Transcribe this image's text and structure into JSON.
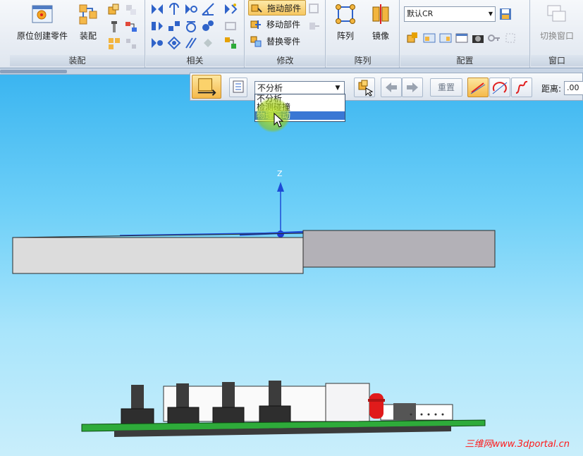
{
  "ribbon": {
    "assembly": {
      "create_in_place_label": "原位创建零件",
      "assemble_label": "装配",
      "group_label": "装配"
    },
    "relations": {
      "group_label": "相关"
    },
    "modify": {
      "drag_part_label": "拖动部件",
      "move_part_label": "移动部件",
      "replace_part_label": "替换零件",
      "group_label": "修改"
    },
    "pattern": {
      "pattern_label": "阵列",
      "mirror_label": "镜像",
      "group_label": "阵列"
    },
    "config": {
      "config_value": "默认CR",
      "group_label": "配置"
    },
    "window": {
      "switch_window_label": "切换窗口",
      "group_label": "窗口"
    }
  },
  "command_bar": {
    "analysis_select_value": "不分析",
    "analysis_options": [
      "不分析",
      "检测碰撞",
      "物理运动"
    ],
    "selected_option_index": 2,
    "reset_label": "重置",
    "distance_label": "距离:",
    "distance_value": ".00"
  },
  "viewport": {
    "z_axis_label": "Z"
  },
  "watermark": "三维网www.3dportal.cn",
  "colors": {
    "accent": "#f5b94a",
    "selection": "#3a77d4",
    "pcb": "#2eab3a",
    "led": "#e01b1b"
  }
}
